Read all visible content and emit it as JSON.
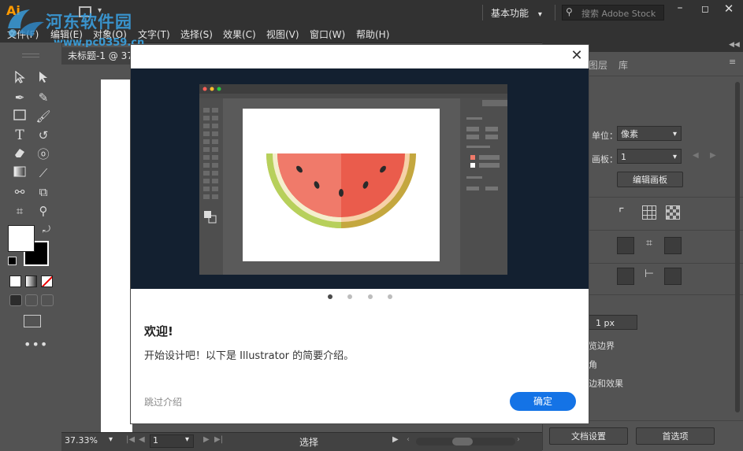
{
  "app": {
    "workspace_label": "基本功能",
    "stock_placeholder": "搜索 Adobe Stock"
  },
  "watermark": {
    "site": "河东软件园",
    "url": "www.pc0359.cn"
  },
  "menu": {
    "items": [
      "文件(F)",
      "编辑(E)",
      "对象(O)",
      "文字(T)",
      "选择(S)",
      "效果(C)",
      "视图(V)",
      "窗口(W)",
      "帮助(H)"
    ]
  },
  "document": {
    "tab_label": "未标题-1 @ 37"
  },
  "status": {
    "zoom": "37.33%",
    "artboard": "1",
    "tool": "选择"
  },
  "panel": {
    "tabs": [
      "图层",
      "库"
    ],
    "unit_label": "单位：",
    "unit_value": "像素",
    "artboard_label": "画板：",
    "artboard_value": "1",
    "edit_artboard": "编辑画板",
    "stroke_value": "1 px",
    "preview_bounds": "览边界",
    "corners": "角",
    "scale_effects": "边和效果",
    "doc_settings": "文档设置",
    "preferences": "首选项"
  },
  "dialog": {
    "title": "欢迎!",
    "body": "开始设计吧！以下是 Illustrator 的简要介绍。",
    "skip": "跳过介绍",
    "ok": "确定",
    "page_count": 4,
    "current_page": 1
  },
  "colors": {
    "accent": "#1473e6",
    "ui_dark": "#323232",
    "ui_mid": "#535353",
    "hero_bg": "#132030"
  }
}
